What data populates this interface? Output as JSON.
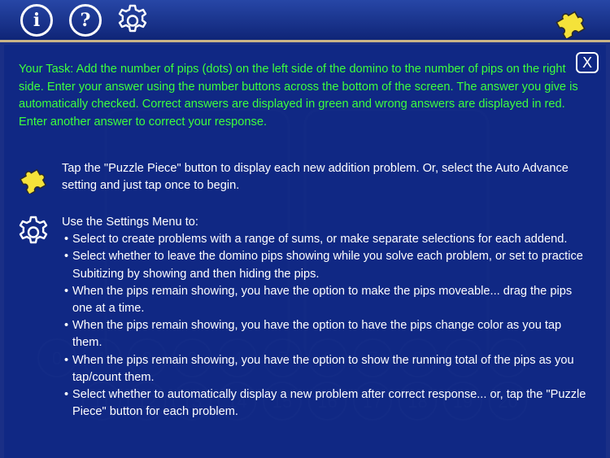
{
  "toolbar": {
    "info_label": "i",
    "help_label": "?",
    "buttons": [
      "info-icon",
      "help-icon",
      "gear-icon",
      "puzzle-icon"
    ]
  },
  "colors": {
    "background": "#1a2f86",
    "task_text": "#3dff3d",
    "body_text": "#ffffff",
    "puzzle_yellow": "#f5e23a",
    "toolbar_border": "#c9b488"
  },
  "help": {
    "close_label": "X",
    "task_text": "Your Task: Add the number of pips (dots) on the left side of the domino to the number of pips on the right side. Enter your answer using the number buttons across the bottom of the screen. The answer you give is automatically checked. Correct answers are displayed in green and wrong answers are displayed in red. Enter another answer to correct your response.",
    "puzzle_text": "Tap the \"Puzzle Piece\" button to display each new addition problem. Or, select the Auto Advance setting and just tap once to begin.",
    "settings_intro": "Use the Settings Menu to:",
    "settings_items": [
      "Select to create problems with a range of sums, or make separate selections for each addend.",
      "Select whether to leave the domino pips showing while you solve each problem, or set to practice Subitizing by showing and then hiding the pips.",
      "When the pips remain showing, you have the option to make the pips moveable...  drag the pips one at a time.",
      "When the pips remain showing, you have the option to have the pips change color as you tap them.",
      "When the pips remain showing, you have the option to show the running total of the pips as you tap/count them.",
      "Select whether to automatically display a new problem after correct response... or, tap the \"Puzzle Piece\" button for each problem."
    ]
  },
  "background_numbers": {
    "row1": [
      "0",
      "1",
      "2",
      "3",
      "4",
      "5",
      "6",
      "7",
      "8",
      "9",
      "10"
    ],
    "row2": [
      "11",
      "12",
      "13",
      "14",
      "15",
      "16",
      "17",
      "18",
      "19",
      "20"
    ]
  }
}
